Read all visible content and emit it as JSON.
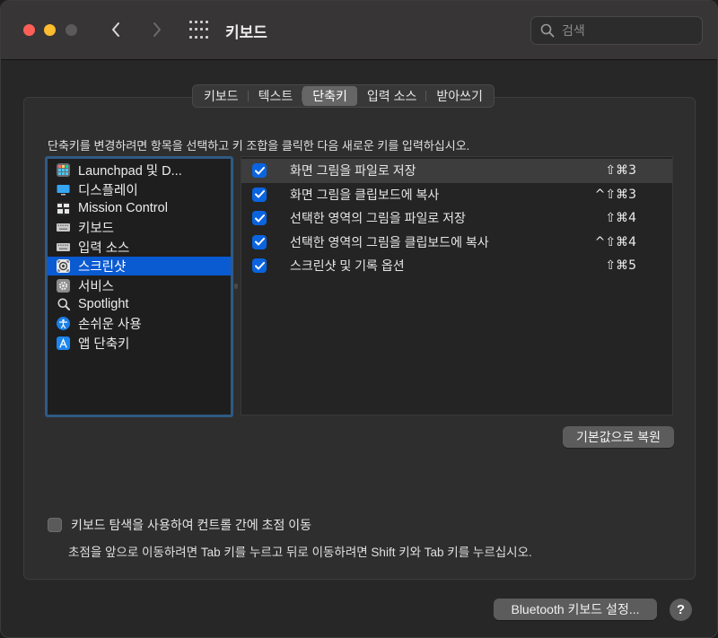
{
  "window": {
    "title": "키보드",
    "search_placeholder": "검색"
  },
  "tabs": [
    {
      "label": "키보드",
      "active": false
    },
    {
      "label": "텍스트",
      "active": false
    },
    {
      "label": "단축키",
      "active": true
    },
    {
      "label": "입력 소스",
      "active": false
    },
    {
      "label": "받아쓰기",
      "active": false
    }
  ],
  "instruction": "단축키를 변경하려면 항목을 선택하고 키 조합을 클릭한 다음 새로운 키를 입력하십시오.",
  "categories": [
    {
      "label": "Launchpad 및 D...",
      "icon": "launchpad-icon"
    },
    {
      "label": "디스플레이",
      "icon": "display-icon"
    },
    {
      "label": "Mission Control",
      "icon": "mission-control-icon"
    },
    {
      "label": "키보드",
      "icon": "keyboard-icon"
    },
    {
      "label": "입력 소스",
      "icon": "input-source-icon"
    },
    {
      "label": "스크린샷",
      "icon": "screenshot-icon",
      "selected": true
    },
    {
      "label": "서비스",
      "icon": "services-gear-icon"
    },
    {
      "label": "Spotlight",
      "icon": "spotlight-icon"
    },
    {
      "label": "손쉬운 사용",
      "icon": "accessibility-icon"
    },
    {
      "label": "앱 단축키",
      "icon": "app-shortcuts-icon"
    }
  ],
  "shortcuts": [
    {
      "label": "화면 그림을 파일로 저장",
      "keys": "⇧⌘3",
      "checked": true
    },
    {
      "label": "화면 그림을 클립보드에 복사",
      "keys": "^⇧⌘3",
      "checked": true
    },
    {
      "label": "선택한 영역의 그림을 파일로 저장",
      "keys": "⇧⌘4",
      "checked": true
    },
    {
      "label": "선택한 영역의 그림을 클립보드에 복사",
      "keys": "^⇧⌘4",
      "checked": true
    },
    {
      "label": "스크린샷 및 기록 옵션",
      "keys": "⇧⌘5",
      "checked": true
    }
  ],
  "buttons": {
    "restore_defaults": "기본값으로 복원",
    "bluetooth_setup": "Bluetooth 키보드 설정...",
    "help": "?"
  },
  "keyboard_navigation": {
    "label": "키보드 탐색을 사용하여 컨트롤 간에 초점 이동",
    "checked": false,
    "description": "초점을 앞으로 이동하려면 Tab 키를 누르고 뒤로 이동하려면 Shift 키와 Tab 키를 누르십시오."
  },
  "colors": {
    "accent": "#0a5ad2",
    "checkbox": "#0a64e0"
  }
}
